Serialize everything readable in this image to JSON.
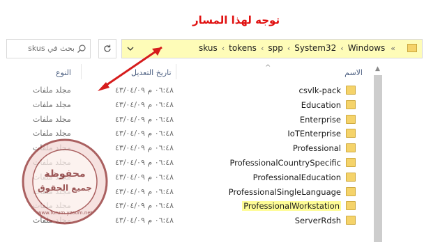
{
  "annotation": "توجه لهذا المسار",
  "search": {
    "placeholder": "بحث في skus"
  },
  "address": {
    "more": "«",
    "crumbs": [
      "Windows",
      "System32",
      "spp",
      "tokens",
      "skus"
    ]
  },
  "columns": {
    "name": "الاسم",
    "date": "تاريخ التعديل",
    "type": "النوع"
  },
  "rows": [
    {
      "name": "csvlk-pack",
      "date": "٠٦:٤٨ م ٤٣/٠٤/٠٩",
      "type": "مجلد ملفات",
      "highlight": false
    },
    {
      "name": "Education",
      "date": "٠٦:٤٨ م ٤٣/٠٤/٠٩",
      "type": "مجلد ملفات",
      "highlight": false
    },
    {
      "name": "Enterprise",
      "date": "٠٦:٤٨ م ٤٣/٠٤/٠٩",
      "type": "مجلد ملفات",
      "highlight": false
    },
    {
      "name": "IoTEnterprise",
      "date": "٠٦:٤٨ م ٤٣/٠٤/٠٩",
      "type": "مجلد ملفات",
      "highlight": false
    },
    {
      "name": "Professional",
      "date": "٠٦:٤٨ م ٤٣/٠٤/٠٩",
      "type": "مجلد ملفات",
      "highlight": false
    },
    {
      "name": "ProfessionalCountrySpecific",
      "date": "٠٦:٤٨ م ٤٣/٠٤/٠٩",
      "type": "مجلد ملفات",
      "highlight": false
    },
    {
      "name": "ProfessionalEducation",
      "date": "٠٦:٤٨ م ٤٣/٠٤/٠٩",
      "type": "مجلد ملفات",
      "highlight": false
    },
    {
      "name": "ProfessionalSingleLanguage",
      "date": "٠٦:٤٨ م ٤٣/٠٤/٠٩",
      "type": "مجلد ملفات",
      "highlight": false
    },
    {
      "name": "ProfessionalWorkstation",
      "date": "٠٦:٤٨ م ٤٣/٠٤/٠٩",
      "type": "مجلد ملفات",
      "highlight": true
    },
    {
      "name": "ServerRdsh",
      "date": "٠٦:٤٨ م ٤٣/٠٤/٠٩",
      "type": "مجلد ملفات",
      "highlight": false
    }
  ],
  "watermark": {
    "line1": "محفوظة",
    "line2": "جميع الحقوق",
    "site": "www.forum.yzoom.net"
  },
  "colors": {
    "address_bg": "#fefcb8",
    "highlight": "#fefc96",
    "annotation": "#e01010",
    "arrow": "#d61c1c",
    "folder": "#f5d36a"
  }
}
